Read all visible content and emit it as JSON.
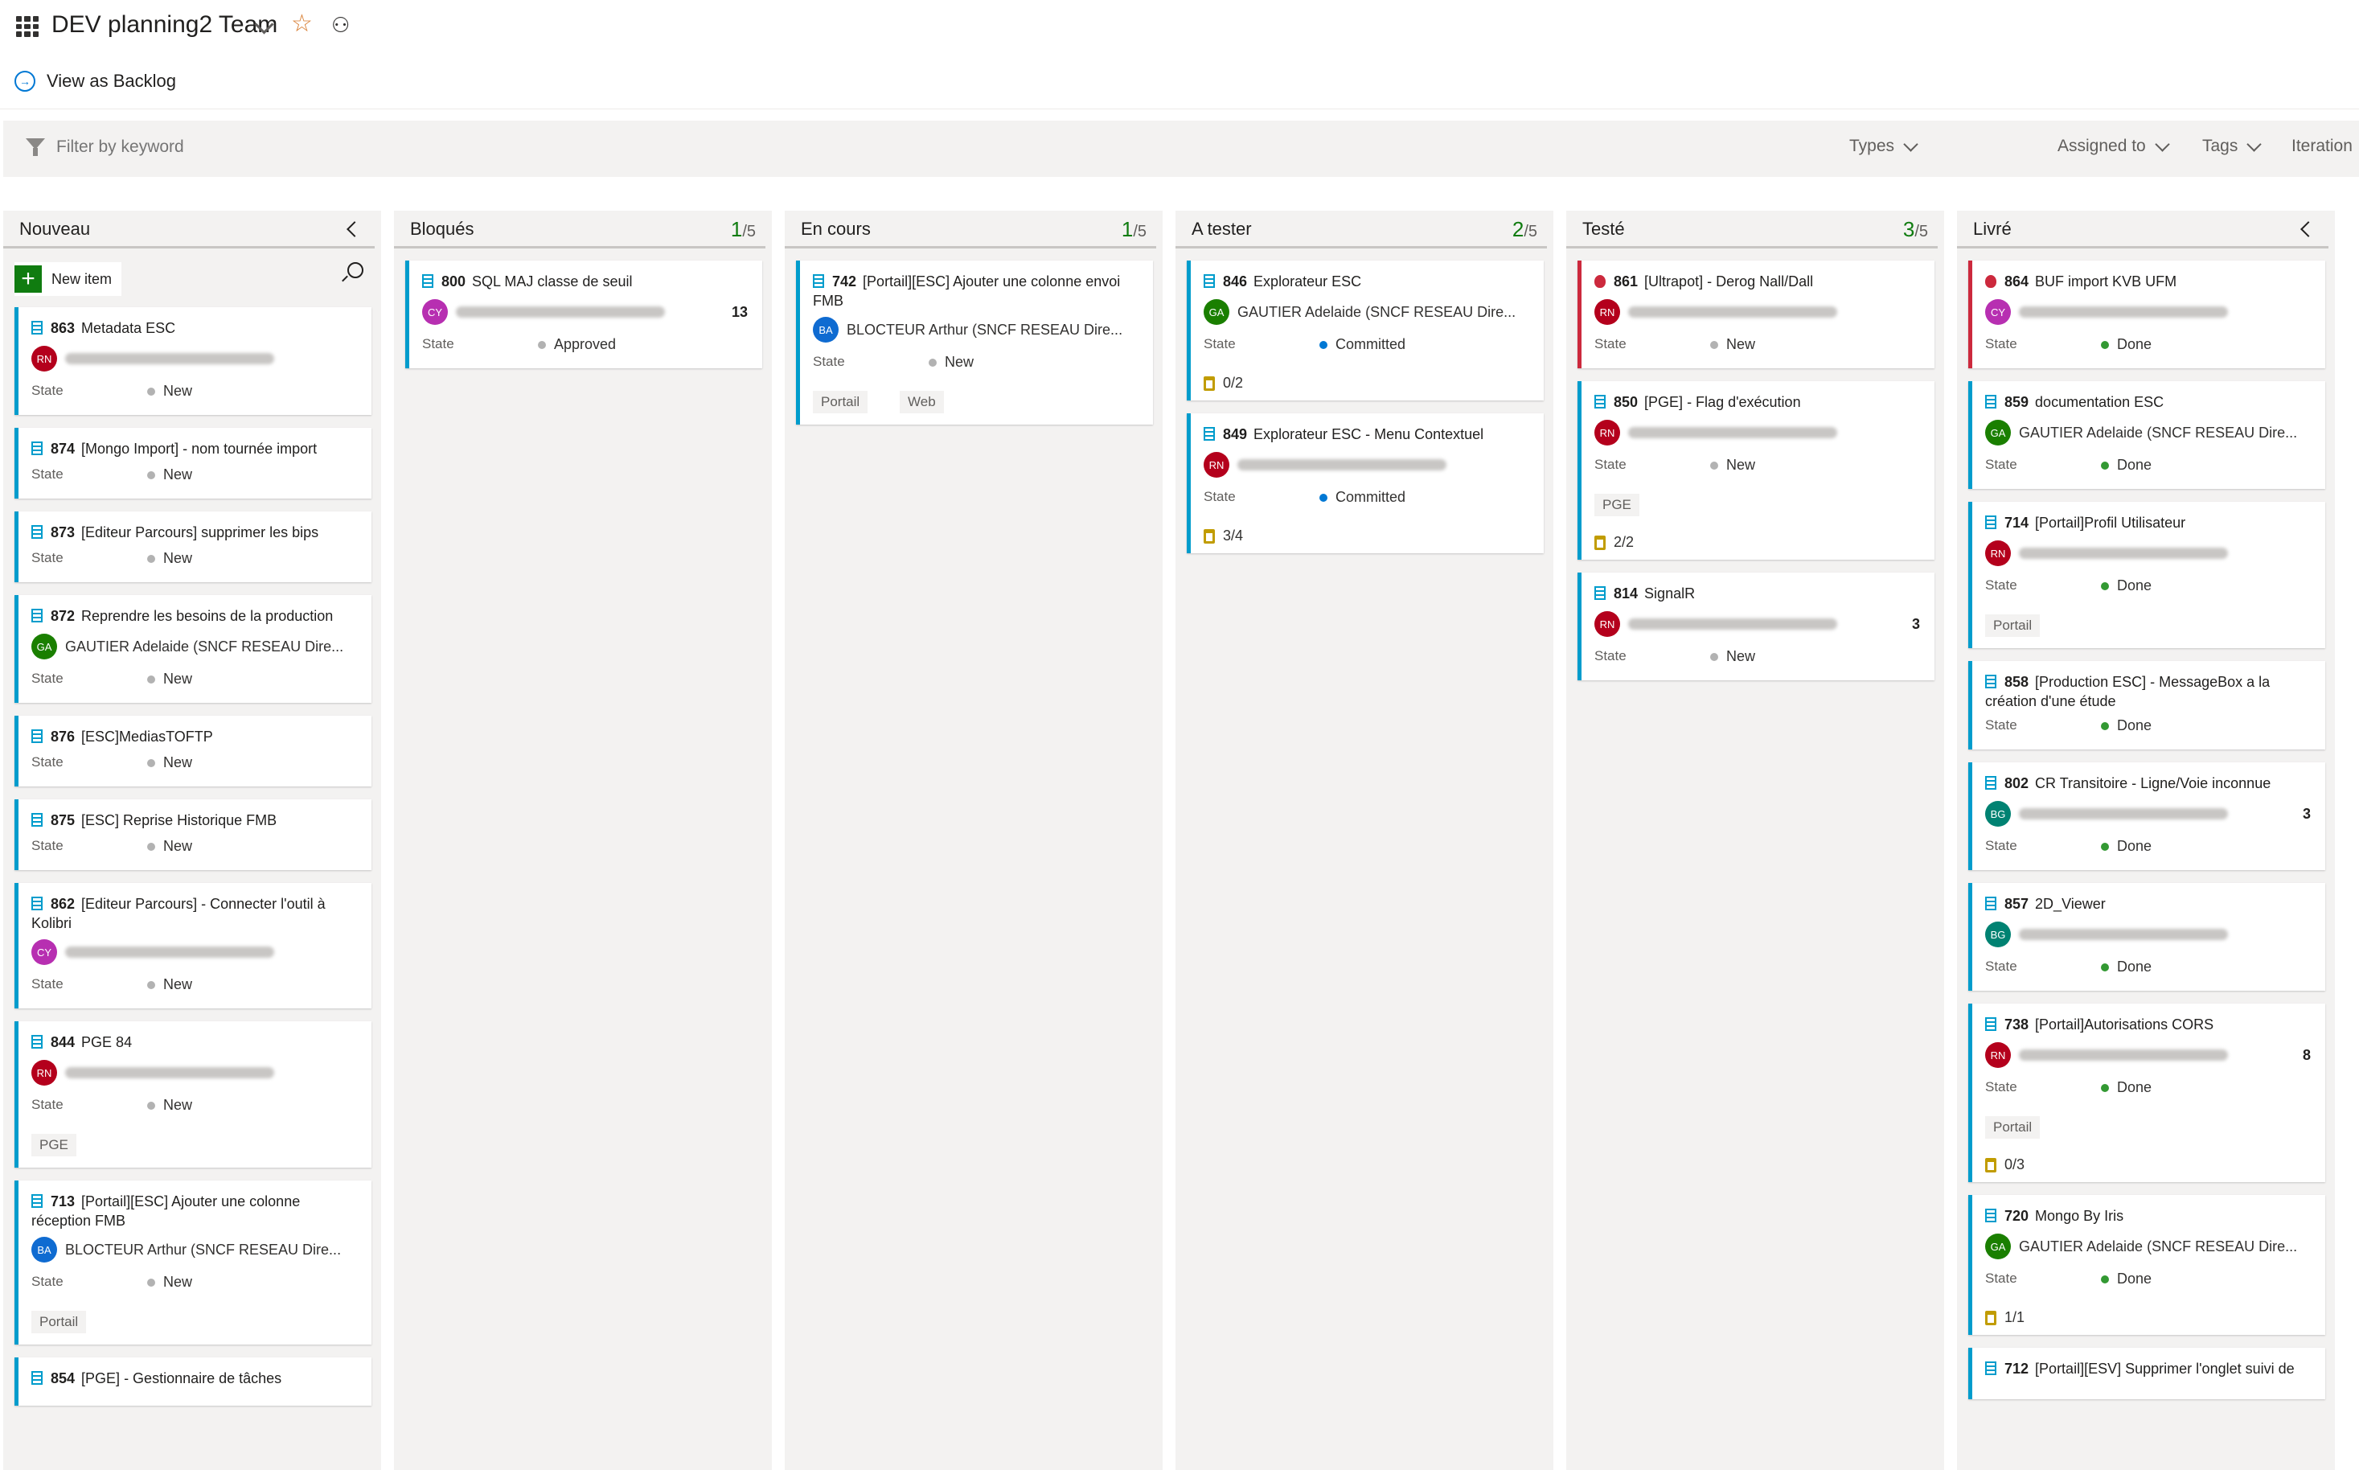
{
  "header": {
    "title": "DEV planning2 Team",
    "view_as_backlog": "View as Backlog",
    "icons": [
      "board-icon",
      "chevron-down-icon",
      "favorite-star-icon",
      "team-members-icon",
      "navigate-circle-icon"
    ]
  },
  "filterbar": {
    "placeholder": "Filter by keyword",
    "types": "Types",
    "assigned_to": "Assigned to",
    "tags": "Tags",
    "iteration": "Iteration"
  },
  "colors": {
    "accent": "#0078d4",
    "story": "#009ccc",
    "bug": "#cc293d",
    "wip_ok": "#107c10",
    "committed": "#0078d4",
    "done": "#339933",
    "new": "#b2b2b2"
  },
  "labels": {
    "state": "State",
    "new_item": "New item"
  },
  "columns": [
    {
      "name": "Nouveau",
      "count": "",
      "limit": "",
      "cards": [
        {
          "id": "863",
          "title": "Metadata ESC",
          "type": "story",
          "avatar": "RN",
          "avatar_color": "#b4001c",
          "assignee": "",
          "state": "New"
        },
        {
          "id": "874",
          "title": "[Mongo Import] - nom tournée import",
          "type": "story",
          "state": "New"
        },
        {
          "id": "873",
          "title": "[Editeur Parcours] supprimer les bips",
          "type": "story",
          "state": "New"
        },
        {
          "id": "872",
          "title": "Reprendre les besoins de la production",
          "type": "story",
          "avatar": "GA",
          "avatar_color": "#1a7f00",
          "assignee": "GAUTIER Adelaide (SNCF RESEAU Dire...",
          "state": "New"
        },
        {
          "id": "876",
          "title": "[ESC]MediasTOFTP",
          "type": "story",
          "state": "New"
        },
        {
          "id": "875",
          "title": "[ESC] Reprise Historique FMB",
          "type": "story",
          "state": "New"
        },
        {
          "id": "862",
          "title": "[Editeur Parcours] - Connecter l'outil à Kolibri",
          "type": "story",
          "avatar": "CY",
          "avatar_color": "#b72fb1",
          "assignee": "",
          "state": "New"
        },
        {
          "id": "844",
          "title": "PGE 84",
          "type": "story",
          "avatar": "RN",
          "avatar_color": "#b4001c",
          "assignee": "",
          "state": "New",
          "tags": [
            "PGE"
          ]
        },
        {
          "id": "713",
          "title": "[Portail][ESC] Ajouter une colonne réception FMB",
          "type": "story",
          "avatar": "BA",
          "avatar_color": "#0f6bd1",
          "assignee": "BLOCTEUR Arthur (SNCF RESEAU Dire...",
          "state": "New",
          "tags": [
            "Portail"
          ]
        },
        {
          "id": "854",
          "title": "[PGE] - Gestionnaire de tâches",
          "type": "story"
        }
      ]
    },
    {
      "name": "Bloqués",
      "count": "1",
      "limit": "/5",
      "cards": [
        {
          "id": "800",
          "title": "SQL MAJ classe de seuil",
          "type": "story",
          "avatar": "CY",
          "avatar_color": "#b72fb1",
          "assignee": "",
          "effort": "13",
          "state": "Approved"
        }
      ]
    },
    {
      "name": "En cours",
      "count": "1",
      "limit": "/5",
      "cards": [
        {
          "id": "742",
          "title": "[Portail][ESC] Ajouter une colonne envoi FMB",
          "type": "story",
          "avatar": "BA",
          "avatar_color": "#0f6bd1",
          "assignee": "BLOCTEUR Arthur (SNCF RESEAU Dire...",
          "state": "New",
          "tags": [
            "Portail",
            "Web"
          ]
        }
      ]
    },
    {
      "name": "A tester",
      "count": "2",
      "limit": "/5",
      "cards": [
        {
          "id": "846",
          "title": "Explorateur ESC",
          "type": "story",
          "avatar": "GA",
          "avatar_color": "#1a7f00",
          "assignee": "GAUTIER Adelaide (SNCF RESEAU Dire...",
          "state": "Committed",
          "tasks": "0/2"
        },
        {
          "id": "849",
          "title": "Explorateur ESC - Menu Contextuel",
          "type": "story",
          "avatar": "RN",
          "avatar_color": "#b4001c",
          "assignee": "",
          "state": "Committed",
          "tasks": "3/4"
        }
      ]
    },
    {
      "name": "Testé",
      "count": "3",
      "limit": "/5",
      "cards": [
        {
          "id": "861",
          "title": "[Ultrapot] - Derog Nall/Dall",
          "type": "bug",
          "avatar": "RN",
          "avatar_color": "#b4001c",
          "assignee": "",
          "state": "New"
        },
        {
          "id": "850",
          "title": "[PGE] - Flag d'exécution",
          "type": "story",
          "avatar": "RN",
          "avatar_color": "#b4001c",
          "assignee": "",
          "state": "New",
          "tags": [
            "PGE"
          ],
          "tasks": "2/2"
        },
        {
          "id": "814",
          "title": "SignalR",
          "type": "story",
          "avatar": "RN",
          "avatar_color": "#b4001c",
          "assignee": "",
          "effort": "3",
          "state": "New"
        }
      ]
    },
    {
      "name": "Livré",
      "count": "",
      "limit": "",
      "cards": [
        {
          "id": "864",
          "title": "BUF import KVB UFM",
          "type": "bug",
          "avatar": "CY",
          "avatar_color": "#b72fb1",
          "assignee": "",
          "state": "Done"
        },
        {
          "id": "859",
          "title": "documentation ESC",
          "type": "story",
          "avatar": "GA",
          "avatar_color": "#1a7f00",
          "assignee": "GAUTIER Adelaide (SNCF RESEAU Dire...",
          "state": "Done"
        },
        {
          "id": "714",
          "title": "[Portail]Profil Utilisateur",
          "type": "story",
          "avatar": "RN",
          "avatar_color": "#b4001c",
          "assignee": "",
          "state": "Done",
          "tags": [
            "Portail"
          ]
        },
        {
          "id": "858",
          "title": "[Production ESC] - MessageBox a la création d'une étude",
          "type": "story",
          "state": "Done"
        },
        {
          "id": "802",
          "title": "CR Transitoire - Ligne/Voie inconnue",
          "type": "story",
          "avatar": "BG",
          "avatar_color": "#008272",
          "assignee": "",
          "effort": "3",
          "state": "Done"
        },
        {
          "id": "857",
          "title": "2D_Viewer",
          "type": "story",
          "avatar": "BG",
          "avatar_color": "#008272",
          "assignee": "",
          "state": "Done"
        },
        {
          "id": "738",
          "title": "[Portail]Autorisations CORS",
          "type": "story",
          "avatar": "RN",
          "avatar_color": "#b4001c",
          "assignee": "",
          "effort": "8",
          "state": "Done",
          "tags": [
            "Portail"
          ],
          "tasks": "0/3"
        },
        {
          "id": "720",
          "title": "Mongo By Iris",
          "type": "story",
          "avatar": "GA",
          "avatar_color": "#1a7f00",
          "assignee": "GAUTIER Adelaide (SNCF RESEAU Dire...",
          "state": "Done",
          "tasks": "1/1"
        },
        {
          "id": "712",
          "title": "[Portail][ESV] Supprimer l'onglet suivi de",
          "type": "story"
        }
      ]
    }
  ]
}
